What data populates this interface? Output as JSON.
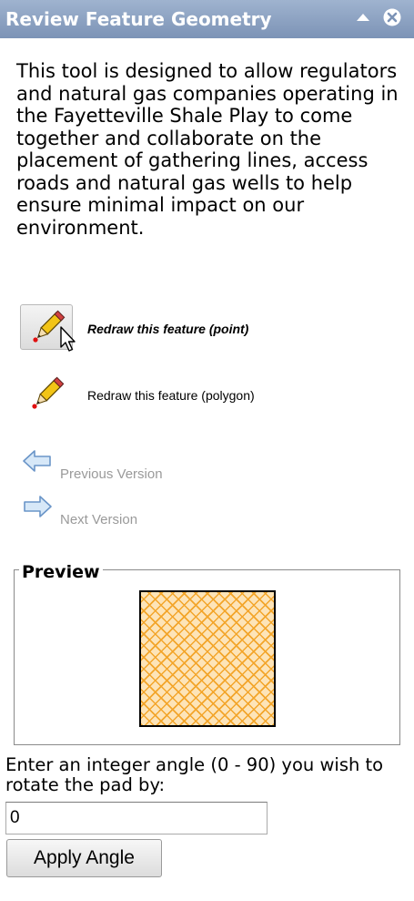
{
  "panel": {
    "title": "Review Feature Geometry"
  },
  "description": "This tool is designed to allow regulators and natural gas companies operating in the Fayetteville Shale Play to come together and collaborate on the placement of gathering lines, access roads and natural gas wells to help ensure minimal impact on our environment.",
  "tools": {
    "redraw_point": "Redraw this feature (point)",
    "redraw_polygon": "Redraw this feature (polygon)"
  },
  "versions": {
    "previous": "Previous Version",
    "next": "Next Version"
  },
  "preview": {
    "legend": "Preview",
    "fill_color": "#fde4b8",
    "hatch_color": "#f3a52a"
  },
  "angle": {
    "label": "Enter an integer angle (0 - 90) you wish to rotate the pad by:",
    "value": "0",
    "apply_label": "Apply Angle"
  },
  "icons": {
    "collapse": "collapse-up-icon",
    "close": "close-icon",
    "pencil": "pencil-icon",
    "cursor": "mouse-cursor-icon",
    "previous": "arrow-left-icon",
    "next": "arrow-right-icon"
  }
}
